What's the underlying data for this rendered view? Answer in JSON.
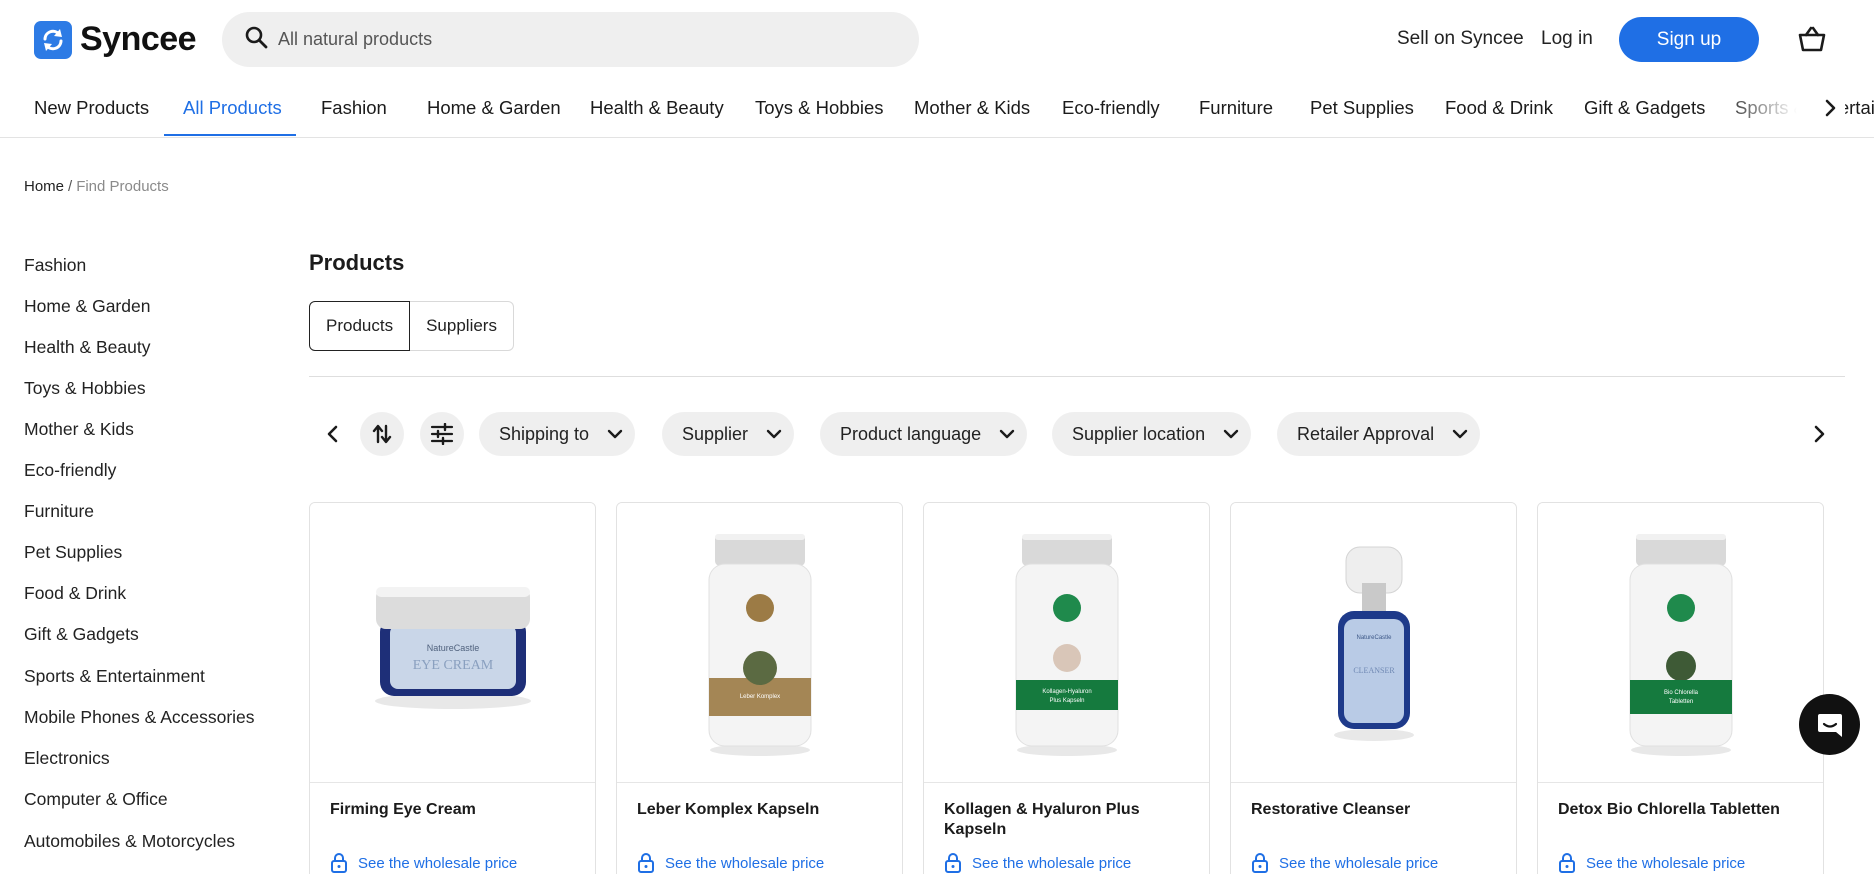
{
  "brand": {
    "name": "Syncee",
    "accent": "#1f6fe5"
  },
  "search": {
    "placeholder": "All natural products"
  },
  "header": {
    "sell_label": "Sell on Syncee",
    "login_label": "Log in",
    "signup_label": "Sign up"
  },
  "catnav": {
    "items": [
      "New Products",
      "All Products",
      "Fashion",
      "Home & Garden",
      "Health & Beauty",
      "Toys & Hobbies",
      "Mother & Kids",
      "Eco-friendly",
      "Furniture",
      "Pet Supplies",
      "Food & Drink",
      "Gift & Gadgets",
      "Sports & Entertainment"
    ],
    "active": "All Products"
  },
  "breadcrumb": {
    "home": "Home",
    "sep": "/",
    "current": "Find Products"
  },
  "sidebar": {
    "items": [
      "Fashion",
      "Home & Garden",
      "Health & Beauty",
      "Toys & Hobbies",
      "Mother & Kids",
      "Eco-friendly",
      "Furniture",
      "Pet Supplies",
      "Food & Drink",
      "Gift & Gadgets",
      "Sports & Entertainment",
      "Mobile Phones & Accessories",
      "Electronics",
      "Computer & Office",
      "Automobiles & Motorcycles"
    ]
  },
  "main": {
    "title": "Products",
    "toggle": {
      "products": "Products",
      "suppliers": "Suppliers"
    },
    "filters": [
      "Shipping to",
      "Supplier",
      "Product language",
      "Supplier location",
      "Retailer Approval"
    ]
  },
  "products": [
    {
      "name": "Firming Eye Cream",
      "price_label": "See the wholesale price",
      "image": "jar"
    },
    {
      "name": "Leber Komplex Kapseln",
      "price_label": "See the wholesale price",
      "image": "bottle-gold"
    },
    {
      "name": "Kollagen & Hyaluron Plus Kapseln",
      "price_label": "See the wholesale price",
      "image": "bottle-green"
    },
    {
      "name": "Restorative Cleanser",
      "price_label": "See the wholesale price",
      "image": "pump"
    },
    {
      "name": "Detox Bio Chlorella Tabletten",
      "price_label": "See the wholesale price",
      "image": "bottle-green"
    }
  ]
}
